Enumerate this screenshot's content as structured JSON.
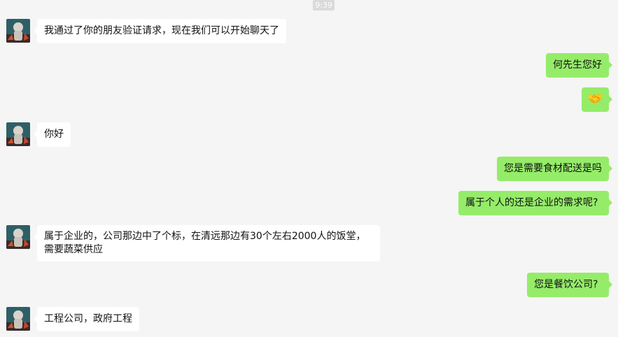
{
  "status": {
    "time": "9:39"
  },
  "messages": [
    {
      "side": "left",
      "text": "我通过了你的朋友验证请求，现在我们可以开始聊天了"
    },
    {
      "side": "right",
      "text": "何先生您好"
    },
    {
      "side": "right",
      "text": "🤝",
      "icon": "handshake-emoji"
    },
    {
      "side": "left",
      "text": "你好"
    },
    {
      "side": "right",
      "text": "您是需要食材配送是吗"
    },
    {
      "side": "right",
      "text": "属于个人的还是企业的需求呢?"
    },
    {
      "side": "left",
      "text": "属于企业的，公司那边中了个标，在清远那边有30个左右2000人的饭堂，需要蔬菜供应"
    },
    {
      "side": "right",
      "text": "您是餐饮公司?"
    },
    {
      "side": "left",
      "text": "工程公司，政府工程"
    }
  ],
  "colors": {
    "background": "#f5f5f5",
    "incoming_bubble": "#ffffff",
    "outgoing_bubble": "#95ec69",
    "time_badge": "#dadada"
  }
}
